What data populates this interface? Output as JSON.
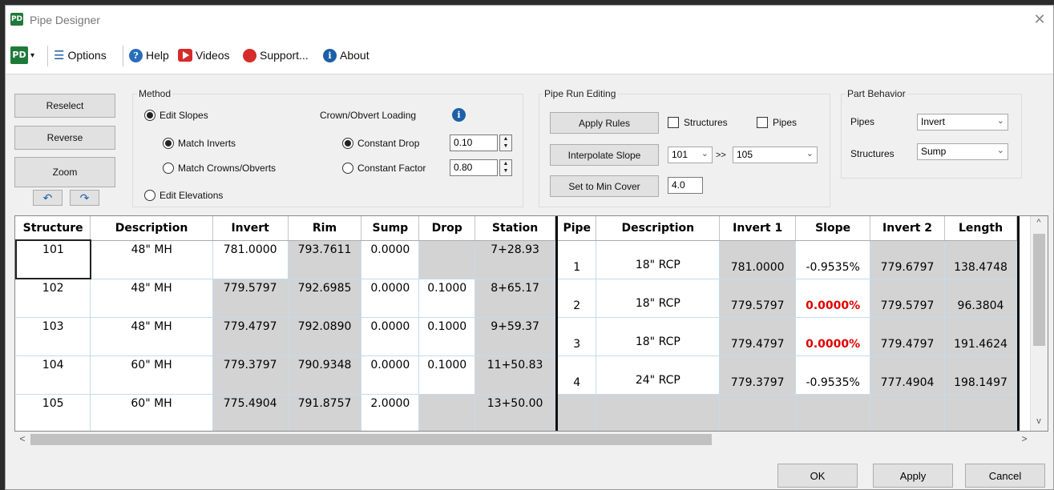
{
  "window": {
    "title": "Pipe Designer",
    "logo_text": "PD",
    "close_glyph": "✕"
  },
  "toolbar": {
    "pd_button": "PD",
    "dropdown_glyph": "▾",
    "options_glyph": "☰",
    "options_label": "Options",
    "help_label": "Help",
    "videos_label": "Videos",
    "support_label": "Support...",
    "about_label": "About",
    "info_glyph": "i",
    "help_glyph": "?"
  },
  "left_buttons": {
    "reselect": "Reselect",
    "reverse": "Reverse",
    "zoom": "Zoom",
    "undo_glyph": "↶",
    "redo_glyph": "↷"
  },
  "method": {
    "title": "Method",
    "edit_slopes": "Edit Slopes",
    "match_inverts": "Match Inverts",
    "match_crowns": "Match Crowns/Obverts",
    "edit_elevations": "Edit Elevations",
    "crown_loading": "Crown/Obvert Loading",
    "constant_drop": "Constant Drop",
    "constant_drop_value": "0.10",
    "constant_factor": "Constant Factor",
    "constant_factor_value": "0.80"
  },
  "pipe_run": {
    "title": "Pipe Run Editing",
    "apply_rules": "Apply Rules",
    "structures": "Structures",
    "pipes": "Pipes",
    "interpolate_slope": "Interpolate Slope",
    "from_value": "101",
    "arrows": ">>",
    "to_value": "105",
    "set_min_cover": "Set to Min Cover",
    "min_cover_value": "4.0"
  },
  "part_behavior": {
    "title": "Part Behavior",
    "pipes_label": "Pipes",
    "pipes_value": "Invert",
    "structures_label": "Structures",
    "structures_value": "Sump"
  },
  "structures_table": {
    "headers": [
      "Structure",
      "Description",
      "Invert",
      "Rim",
      "Sump",
      "Drop",
      "Station"
    ],
    "rows": [
      [
        "101",
        "48\" MH",
        "781.0000",
        "793.7611",
        "0.0000",
        "",
        "7+28.93"
      ],
      [
        "102",
        "48\" MH",
        "779.5797",
        "792.6985",
        "0.0000",
        "0.1000",
        "8+65.17"
      ],
      [
        "103",
        "48\" MH",
        "779.4797",
        "792.0890",
        "0.0000",
        "0.1000",
        "9+59.37"
      ],
      [
        "104",
        "60\" MH",
        "779.3797",
        "790.9348",
        "0.0000",
        "0.1000",
        "11+50.83"
      ],
      [
        "105",
        "60\" MH",
        "775.4904",
        "791.8757",
        "2.0000",
        "",
        "13+50.00"
      ]
    ]
  },
  "pipes_table": {
    "headers": [
      "Pipe",
      "Description",
      "Invert 1",
      "Slope",
      "Invert 2",
      "Length"
    ],
    "rows": [
      [
        "1",
        "18\" RCP",
        "781.0000",
        "-0.9535%",
        "779.6797",
        "138.4748"
      ],
      [
        "2",
        "18\" RCP",
        "779.5797",
        "0.0000%",
        "779.5797",
        "96.3804"
      ],
      [
        "3",
        "18\" RCP",
        "779.4797",
        "0.0000%",
        "779.4797",
        "191.4624"
      ],
      [
        "4",
        "24\" RCP",
        "779.3797",
        "-0.9535%",
        "777.4904",
        "198.1497"
      ]
    ]
  },
  "scroll": {
    "up": "^",
    "down": "v",
    "left": "<",
    "right": ">"
  },
  "footer": {
    "ok": "OK",
    "apply": "Apply",
    "cancel": "Cancel"
  },
  "colors": {
    "brand": "#1f7a3a",
    "warning": "#e00000",
    "locked_cell": "#d3d3d3"
  }
}
